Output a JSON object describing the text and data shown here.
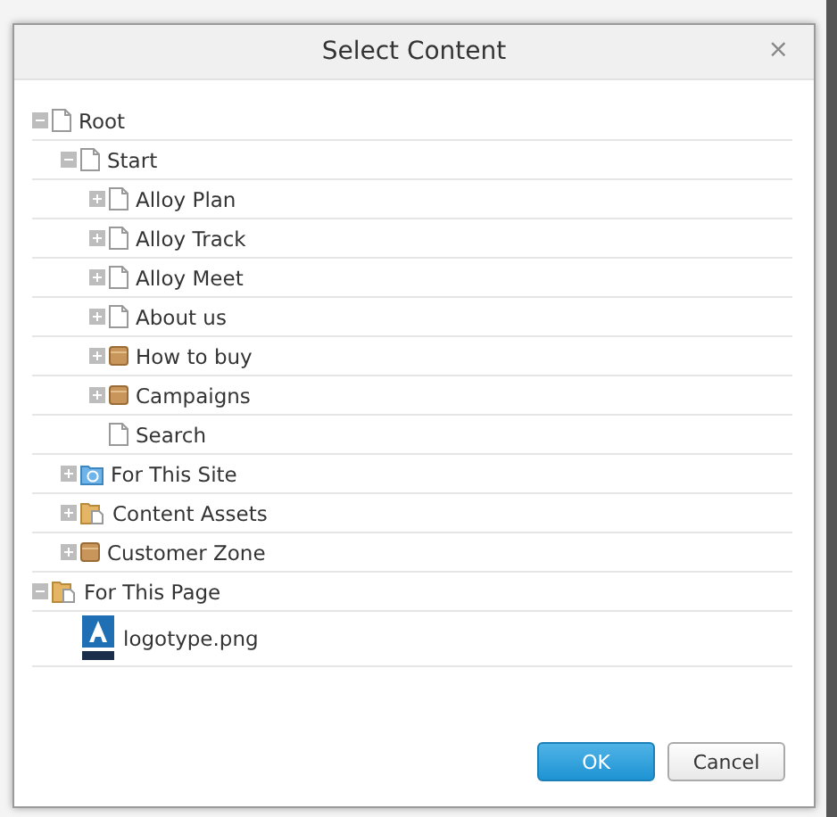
{
  "dialog": {
    "title": "Select Content",
    "close": "×"
  },
  "tree": [
    {
      "label": "Root",
      "kind": "page",
      "expanded": true,
      "children": [
        {
          "label": "Start",
          "kind": "page",
          "expanded": true,
          "children": [
            {
              "label": "Alloy Plan",
              "kind": "page",
              "expanded": false
            },
            {
              "label": "Alloy Track",
              "kind": "page",
              "expanded": false
            },
            {
              "label": "Alloy Meet",
              "kind": "page",
              "expanded": false
            },
            {
              "label": "About us",
              "kind": "page",
              "expanded": false
            },
            {
              "label": "How to buy",
              "kind": "container",
              "expanded": false
            },
            {
              "label": "Campaigns",
              "kind": "container",
              "expanded": false
            },
            {
              "label": "Search",
              "kind": "page"
            }
          ]
        },
        {
          "label": "For This Site",
          "kind": "site",
          "expanded": false
        },
        {
          "label": "Content Assets",
          "kind": "assets",
          "expanded": false
        },
        {
          "label": "Customer Zone",
          "kind": "container",
          "expanded": false
        }
      ]
    },
    {
      "label": "For This Page",
      "kind": "assets",
      "expanded": true,
      "children": [
        {
          "label": "logotype.png",
          "kind": "image"
        }
      ]
    }
  ],
  "buttons": [
    {
      "label": "OK",
      "kind": "primary"
    },
    {
      "label": "Cancel",
      "kind": "secondary"
    }
  ]
}
